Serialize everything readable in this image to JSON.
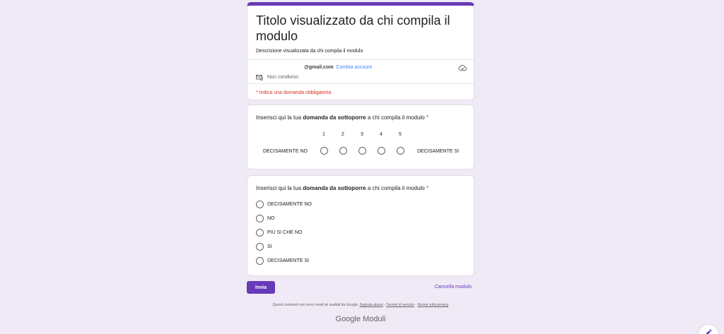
{
  "form": {
    "title": "Titolo visualizzato da chi compila il modulo",
    "description": "Descrizione visualizzata da chi compila il modulo",
    "account_email": "@gmail.com",
    "switch_account": "Cambia account",
    "not_shared": "Non condiviso",
    "required_note": "* Indica una domanda obbligatoria"
  },
  "question1": {
    "prefix": "Inserisci qui la tua ",
    "bold": "domanda da sottoporre",
    "suffix": " a chi compila il modulo ",
    "required": "*",
    "scale": [
      "1",
      "2",
      "3",
      "4",
      "5"
    ],
    "low_label": "DECISAMENTE NO",
    "high_label": "DECISAMENTE SI"
  },
  "question2": {
    "prefix": "Inserisci qui la tua ",
    "bold": "domanda da sottoporre",
    "suffix": " a chi compila il modulo ",
    "required": "*",
    "options": [
      "DECISAMENTE NO",
      "NO",
      "PIÙ SI CHE NO",
      "SI",
      "DECISAMENTE SI"
    ]
  },
  "actions": {
    "submit": "Invia",
    "clear": "Cancella modulo"
  },
  "footer": {
    "note": "Questi contenuti non sono creati né avallati da Google.",
    "report": "Segnala abuso",
    "sep1": " - ",
    "terms": "Termini di servizio",
    "sep2": " - ",
    "privacy": "Norme sulla privacy",
    "brand_google": "Google",
    "brand_product": "Moduli"
  },
  "colors": {
    "accent": "#673ab7",
    "background": "#efeaf6",
    "required": "#d93025",
    "link": "#4285f4"
  },
  "icons": {
    "cloud": "cloud-icon",
    "not_shared": "not-shared-icon",
    "edit": "pencil-icon"
  }
}
